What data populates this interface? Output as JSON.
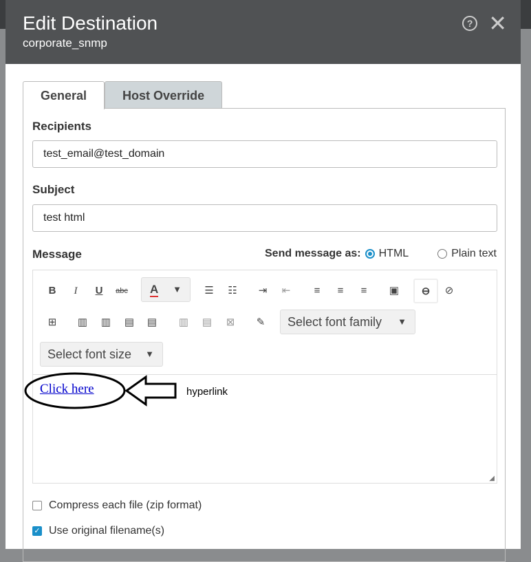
{
  "dialog": {
    "title": "Edit Destination",
    "subtitle": "corporate_snmp"
  },
  "tabs": [
    {
      "label": "General",
      "active": true
    },
    {
      "label": "Host Override",
      "active": false
    }
  ],
  "recipients": {
    "label": "Recipients",
    "value": "test_email@test_domain"
  },
  "subject": {
    "label": "Subject",
    "value": "test html"
  },
  "message": {
    "label": "Message",
    "send_as_label": "Send message as:",
    "options": [
      "HTML",
      "Plain text"
    ],
    "selected": "HTML"
  },
  "toolbar": {
    "bold": "B",
    "italic": "I",
    "underline": "U",
    "strike": "abc",
    "font_color": "A",
    "font_family": "Select font family",
    "font_size": "Select font size"
  },
  "editor": {
    "link_text": "Click here",
    "annotation": "hyperlink"
  },
  "options": [
    {
      "label": "Compress each file (zip format)",
      "checked": false
    },
    {
      "label": "Use original filename(s)",
      "checked": true
    }
  ],
  "colors": {
    "header": "#505254",
    "accent": "#1a8fc9",
    "link": "#0000cc"
  }
}
